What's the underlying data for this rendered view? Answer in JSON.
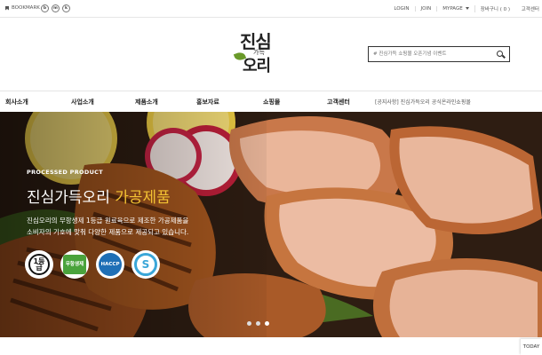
{
  "topbar": {
    "bookmark": "BOOKMARK",
    "sns": [
      "b",
      "m",
      "k"
    ],
    "links": [
      "LOGIN",
      "JOIN",
      "MYPAGE",
      "장바구니 ( 0 )"
    ],
    "customer_center": "고객센터"
  },
  "header": {
    "logo_top": "진심",
    "logo_mid": "가득",
    "logo_bottom": "오리",
    "search_placeholder": "# 진심가득 쇼핑몰 오픈기념 이벤트"
  },
  "nav": {
    "items": [
      "회사소개",
      "사업소개",
      "제품소개",
      "홍보자료",
      "쇼핑몰",
      "고객센터"
    ],
    "notice": "[공지사항] 진심가득오리 공식온라인쇼핑몰"
  },
  "hero": {
    "label": "PROCESSED PRODUCT",
    "headline_main": "진심가득오리 ",
    "headline_accent": "가공제품",
    "desc_line1": "진심오리의 무항생제 1등급 원료육으로 제조한 가공제품을",
    "desc_line2": "소비자의 기호에 맞춰 다양한 제품으로 제공되고 있습니다.",
    "badges": [
      "1등급",
      "무항생제",
      "HACCP",
      "S"
    ],
    "slides": 3,
    "active_slide": 3
  },
  "today": "TODAY",
  "colors": {
    "accent": "#f3c233",
    "bg_dark": "#2b1c12"
  }
}
